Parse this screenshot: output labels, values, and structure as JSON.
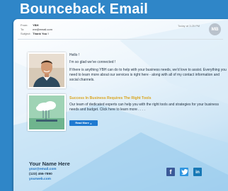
{
  "page": {
    "title": "Bounceback Email"
  },
  "email": {
    "from_label": "From:",
    "from_value": "YBH",
    "to_label": "To:",
    "to_value": "me@email.com",
    "subject_label": "Subject:",
    "subject_value": "Thank You !",
    "timestamp": "Today at 3:25 PM",
    "avatar_initials": "MB"
  },
  "body": {
    "greeting": "Hello !",
    "glad": "I'm so glad we've connected !",
    "paragraph1": "If there is anything YBH can do to help with your business needs, we'd love to assist. Everything you need to learn more about our services is right here - along with all of my contact information and social channels.",
    "promo_heading": "Success In Business Requires The Right Tools",
    "promo_text": "Our team of dedicated experts can help you with the right tools and strategies for your business needs and budget. Click here to learn more . . . .",
    "read_more": "Read More",
    "read_more_arrow": "▸"
  },
  "signature": {
    "name": "Your Name Here",
    "email": "your@email.com",
    "phone": "(123) 456-7890",
    "website": "yourweb.com"
  },
  "social": [
    {
      "icon": "facebook-icon",
      "glyph": "f"
    },
    {
      "icon": "twitter-icon",
      "glyph": "♣"
    },
    {
      "icon": "linkedin-icon",
      "glyph": "in"
    }
  ]
}
